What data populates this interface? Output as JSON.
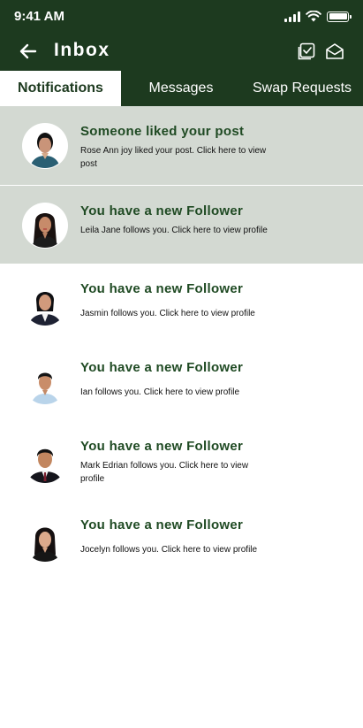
{
  "status_bar": {
    "time": "9:41 AM"
  },
  "header": {
    "title": "Inbox",
    "back_icon": "arrow-left-icon",
    "actions": [
      "check-square-icon",
      "mail-open-icon"
    ]
  },
  "tabs": [
    {
      "label": "Notifications",
      "active": true
    },
    {
      "label": "Messages",
      "active": false
    },
    {
      "label": "Swap Requests",
      "active": false
    }
  ],
  "notifications": [
    {
      "title": "Someone liked your post",
      "body": "Rose Ann joy liked your post. Click here to view post",
      "unread": true,
      "avatar": "avatar-rose-ann"
    },
    {
      "title": "You have a new Follower",
      "body": "Leila Jane follows you. Click here to view profile",
      "unread": true,
      "avatar": "avatar-leila-jane"
    },
    {
      "title": "You have a new Follower",
      "body": "Jasmin follows you. Click here to view profile",
      "unread": false,
      "avatar": "avatar-jasmin"
    },
    {
      "title": "You have a new  Follower",
      "body": "Ian follows you. Click here to view profile",
      "unread": false,
      "avatar": "avatar-ian"
    },
    {
      "title": "You have a new Follower",
      "body": "Mark Edrian follows you. Click here to view profile",
      "unread": false,
      "avatar": "avatar-mark-edrian"
    },
    {
      "title": "You have a new Follower",
      "body": "Jocelyn follows you. Click here to view profile",
      "unread": false,
      "avatar": "avatar-jocelyn"
    }
  ],
  "colors": {
    "primary": "#1d3a1f",
    "unread_bg": "#d3d9d2",
    "title_text": "#1f4a23"
  }
}
